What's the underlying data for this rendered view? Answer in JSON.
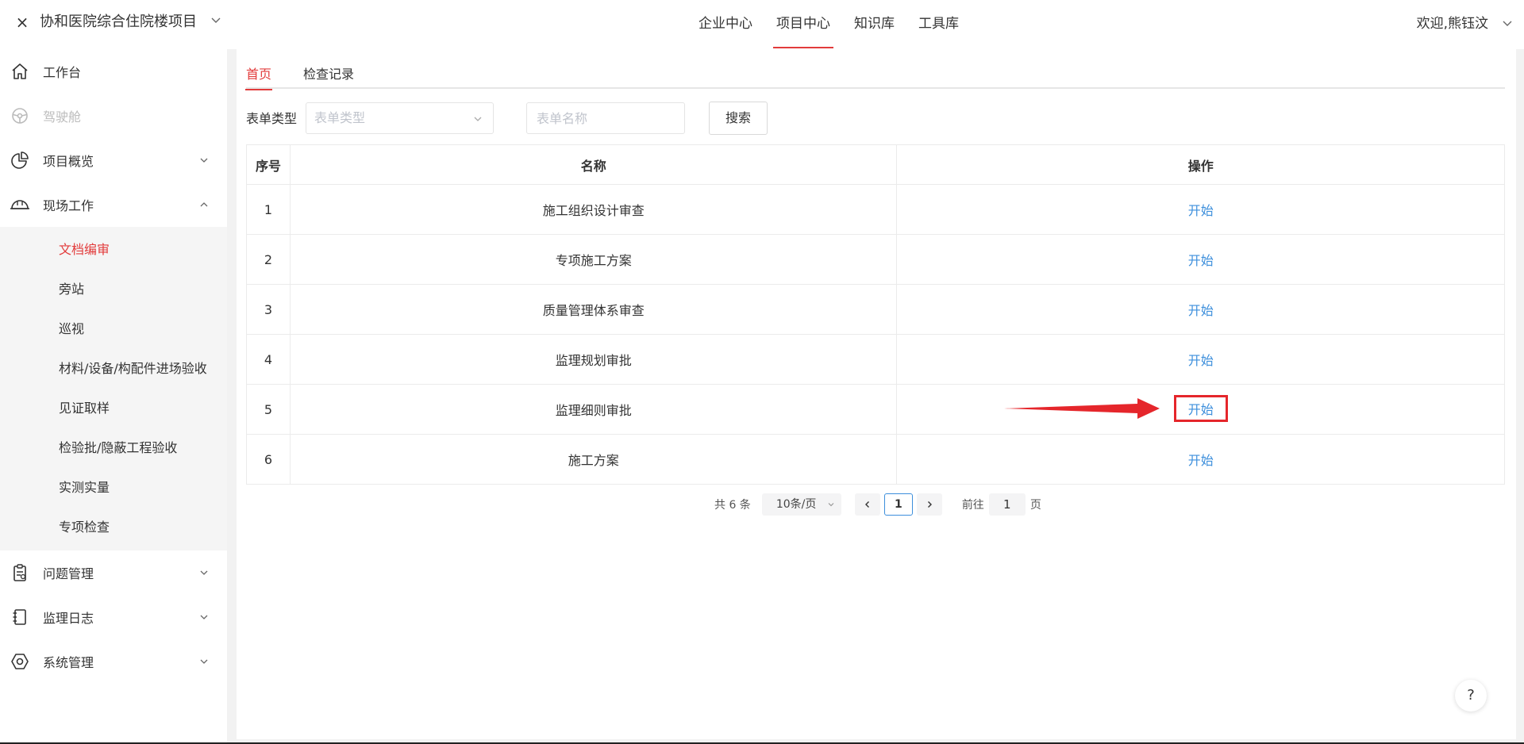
{
  "header": {
    "close_glyph": "×",
    "project_title": "协和医院综合住院楼项目",
    "nav": [
      "企业中心",
      "项目中心",
      "知识库",
      "工具库"
    ],
    "active_nav_index": 1,
    "welcome": "欢迎,熊钰汶"
  },
  "sidebar": {
    "items": [
      {
        "label": "工作台",
        "icon": "home-icon",
        "disabled": false,
        "chevron": ""
      },
      {
        "label": "驾驶舱",
        "icon": "steering-wheel-icon",
        "disabled": true,
        "chevron": ""
      },
      {
        "label": "项目概览",
        "icon": "pie-chart-icon",
        "disabled": false,
        "chevron": "down"
      },
      {
        "label": "现场工作",
        "icon": "hard-hat-icon",
        "disabled": false,
        "chevron": "up"
      }
    ],
    "submenu": [
      "文档编审",
      "旁站",
      "巡视",
      "材料/设备/构配件进场验收",
      "见证取样",
      "检验批/隐蔽工程验收",
      "实测实量",
      "专项检查"
    ],
    "active_sub_index": 0,
    "bottom_items": [
      {
        "label": "问题管理",
        "icon": "clipboard-icon",
        "chevron": "down"
      },
      {
        "label": "监理日志",
        "icon": "notebook-icon",
        "chevron": "down"
      },
      {
        "label": "系统管理",
        "icon": "settings-icon",
        "chevron": "down"
      }
    ]
  },
  "tabs": [
    "首页",
    "检查记录"
  ],
  "active_tab_index": 0,
  "filter": {
    "label": "表单类型",
    "select_placeholder": "表单类型",
    "name_placeholder": "表单名称",
    "search_label": "搜索"
  },
  "table": {
    "headers": [
      "序号",
      "名称",
      "操作"
    ],
    "rows": [
      {
        "no": "1",
        "name": "施工组织设计审查",
        "op": "开始"
      },
      {
        "no": "2",
        "name": "专项施工方案",
        "op": "开始"
      },
      {
        "no": "3",
        "name": "质量管理体系审查",
        "op": "开始"
      },
      {
        "no": "4",
        "name": "监理规划审批",
        "op": "开始"
      },
      {
        "no": "5",
        "name": "监理细则审批",
        "op": "开始"
      },
      {
        "no": "6",
        "name": "施工方案",
        "op": "开始"
      }
    ],
    "highlighted_row_index": 4
  },
  "pagination": {
    "total": "共 6 条",
    "page_size": "10条/页",
    "current_page": "1",
    "goto_label": "前往",
    "goto_value": "1",
    "page_suffix": "页"
  },
  "help_label": "?",
  "colors": {
    "accent_red": "#e23b3b",
    "link_blue": "#3d8fdc",
    "annotation_red": "#e5262b"
  }
}
